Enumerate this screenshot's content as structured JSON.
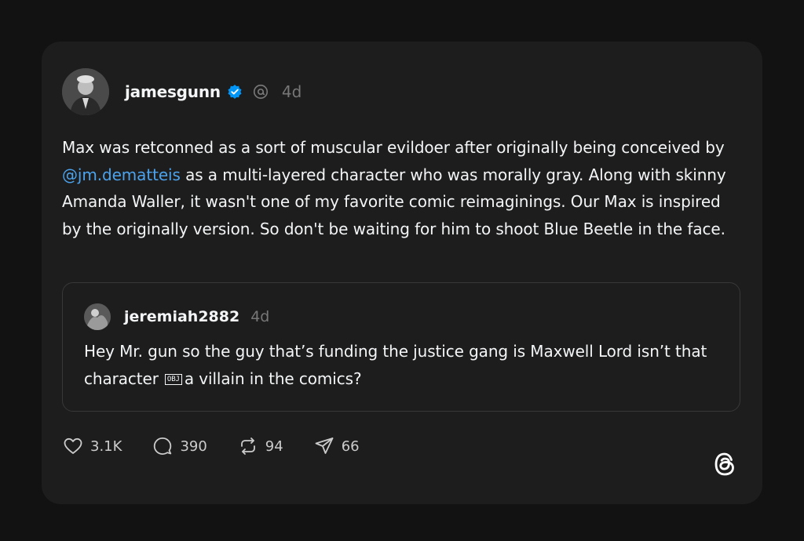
{
  "post": {
    "username": "jamesgunn",
    "time": "4d",
    "text": {
      "before_mention": "Max was retconned as a sort of muscular evildoer after originally being conceived by ",
      "mention": "@jm.dematteis",
      "after_mention": " as a multi-layered character who was morally gray. Along with skinny Amanda Waller, it wasn't one of my favorite comic reimaginings. Our Max is inspired by the originally version. So don't be waiting for him to shoot Blue Beetle in the face."
    }
  },
  "quoted_post": {
    "username": "jeremiah2882",
    "time": "4d",
    "text_before": "Hey Mr. gun so the guy that’s funding the justice gang is Maxwell Lord isn’t that character",
    "object_glyph": "OBJ",
    "text_after": "a villain in the comics?"
  },
  "actions": {
    "likes": "3.1K",
    "replies": "390",
    "reposts": "94",
    "shares": "66"
  },
  "icons": {
    "verified": "verified-badge-icon",
    "threads": "threads-logo-icon",
    "like": "heart-icon",
    "reply": "comment-bubble-icon",
    "repost": "repost-icon",
    "share": "send-icon"
  },
  "colors": {
    "page_background": "#121212",
    "card_background": "#1d1d1d",
    "text": "#f3f5f7",
    "muted_text": "#777777",
    "mention": "#4ba3ee",
    "verified": "#0095f6"
  }
}
